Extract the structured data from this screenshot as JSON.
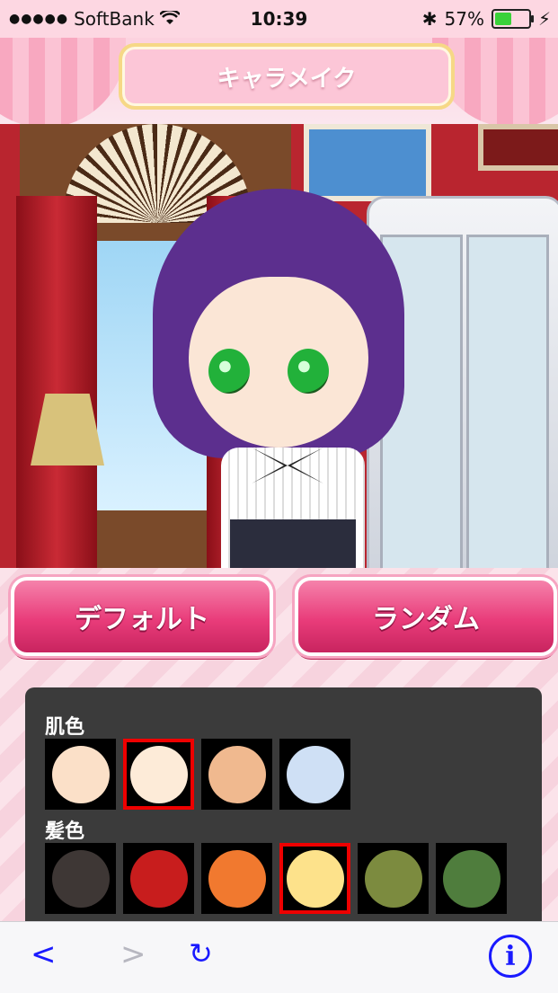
{
  "status_bar": {
    "carrier": "SoftBank",
    "time": "10:39",
    "battery_percent": "57%",
    "battery_level": 0.57
  },
  "header": {
    "title": "キャラメイク"
  },
  "buttons": {
    "default_label": "デフォルト",
    "random_label": "ランダム"
  },
  "skin": {
    "label": "肌色",
    "colors": [
      "#fbe0c8",
      "#fdebd8",
      "#f0b98f",
      "#cfe0f5"
    ],
    "selected_index": 1
  },
  "hair": {
    "label": "髪色",
    "colors": [
      "#3e3735",
      "#c81d1d",
      "#f1792f",
      "#fde28b",
      "#7c8b3f",
      "#4f7d3d"
    ],
    "selected_index": 3
  },
  "toolbar": {
    "back": "<",
    "forward": ">",
    "reload": "↻",
    "info": "i"
  }
}
